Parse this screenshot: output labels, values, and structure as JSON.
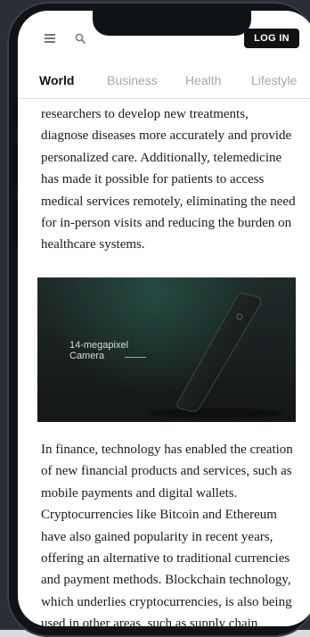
{
  "header": {
    "login_label": "LOG IN"
  },
  "tabs": [
    "World",
    "Business",
    "Health",
    "Lifestyle"
  ],
  "article": {
    "paragraph_top": [
      "researchers to develop new treatments,",
      "diagnose diseases more accurately and provide",
      "personalized care. Additionally, telemedicine",
      "has made it possible for patients to access",
      "medical services remotely, eliminating the need",
      "for in-person visits and reducing the burden on",
      "healthcare systems."
    ],
    "image_caption": [
      "14-megapixel",
      "Camera"
    ],
    "paragraph_bottom": [
      "In finance, technology has enabled the creation",
      "of new financial products and services, such as",
      "mobile payments and digital wallets.",
      "Cryptocurrencies like Bitcoin and Ethereum",
      "have also gained popularity in recent years,",
      "offering an alternative to traditional currencies",
      "and payment methods. Blockchain technology,",
      "which underlies cryptocurrencies, is also being",
      "used in other areas, such as supply chain"
    ]
  },
  "icons": {
    "menu": "hamburger-menu-icon",
    "search": "search-icon"
  },
  "colors": {
    "accent_line": "#5ec7a8",
    "active_tab": "#111111",
    "inactive_tab": "#a7a7a7",
    "login_bg": "#111111"
  }
}
